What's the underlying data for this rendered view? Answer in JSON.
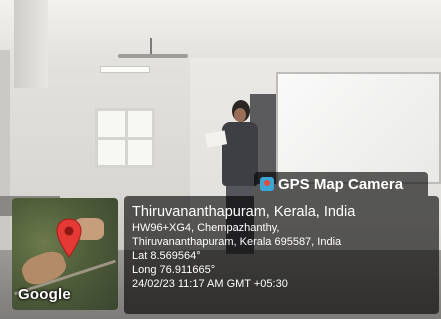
{
  "watermark": {
    "app_name": "GPS Map Camera",
    "place": "Thiruvananthapuram, Kerala, India",
    "plus_code_line": "HW96+XG4, Chempazhanthy,",
    "address_line": "Thiruvananthapuram, Kerala 695587, India",
    "latitude": "Lat 8.569564°",
    "longitude": "Long 76.911665°",
    "datetime": "24/02/23 11:17 AM GMT +05:30"
  },
  "map": {
    "provider_logo": "Google",
    "pin_icon": "map-pin-icon",
    "pin_color": "#e53935"
  },
  "colors": {
    "overlay": "rgba(0,0,0,0.62)",
    "app_icon": "#3ba6d6"
  }
}
